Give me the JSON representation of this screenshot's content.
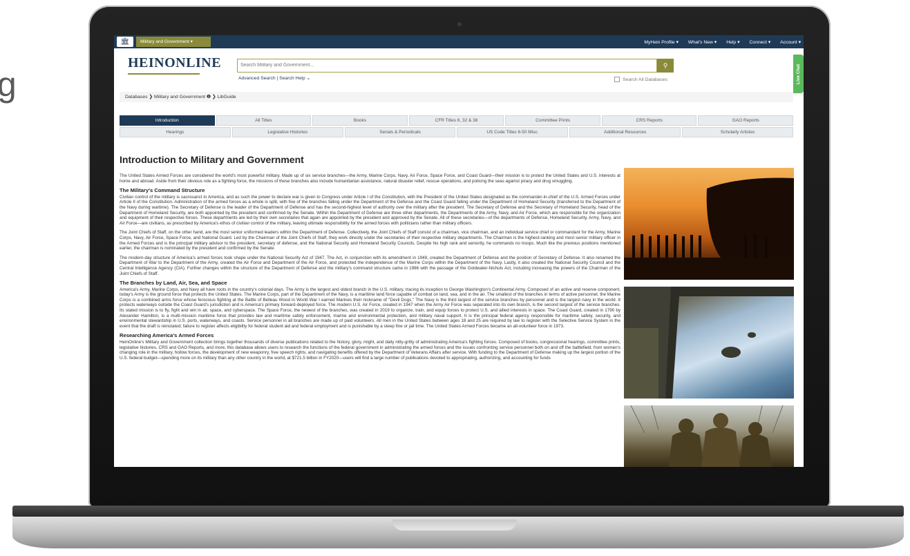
{
  "edge_text": "g",
  "topbar": {
    "db_selector": "Military and Government ▾",
    "nav": [
      "MyHein Profile ▾",
      "What's New ▾",
      "Help ▾",
      "Connect ▾",
      "Account ▾"
    ]
  },
  "header": {
    "logo": "HEINONLINE",
    "search_placeholder": "Search Military and Government...",
    "advanced_links": "Advanced Search | Search Help",
    "search_all": "Search All Databases",
    "live_chat": "Live Chat"
  },
  "breadcrumb": "Databases ❯ Military and Government ❶ ❯ LibGuide",
  "tabs": {
    "row1": [
      "Introduction",
      "All Titles",
      "Books",
      "CFR Titles 6, 32 & 38",
      "Committee Prints",
      "CRS Reports",
      "GAO Reports"
    ],
    "row2": [
      "Hearings",
      "Legislative Histories",
      "Serials & Periodicals",
      "US Code Titles 6-50 Misc.",
      "Additional Resources",
      "Scholarly Articles"
    ]
  },
  "page_title": "Introduction to Military and Government",
  "sections": {
    "intro": "The United States Armed Forces are considered the world's most powerful military. Made up of six service branches—the Army, Marine Corps, Navy, Air Force, Space Force, and Coast Guard—their mission is to protect the United States and U.S. interests at home and abroad. Aside from their obvious role as a fighting force, the missions of these branches also include humanitarian assistance, natural disaster relief, rescue operations, and policing the seas against piracy and drug smuggling.",
    "h1": "The Military's Command Structure",
    "p1": "Civilian control of the military is sacrosanct in America, and as such the power to declare war is given to Congress under Article I of the Constitution, with the President of the United States designated as the commander-in-chief of the U.S. Armed Forces under Article II of the Constitution. Administration of the armed forces as a whole is split, with five of the branches falling under the Department of the Defense and the Coast Guard falling under the Department of Homeland Security (transferred to the Department of the Navy during wartime). The Secretary of Defense is the leader of the Department of Defense and has the second-highest level of authority over the military after the president. The Secretary of Defense and the Secretary of Homeland Security, head of the Department of Homeland Security, are both appointed by the president and confirmed by the Senate. Within the Department of Defense are three other departments, the Departments of the Army, Navy, and Air Force, which are responsible for the organization and equipment of their respective forces. These departments are led by their own secretaries that again are appointed by the president and approved by the Senate. All of these secretaries—of the departments of Defense, Homeland Security, Army, Navy, and Air Force—are civilians, as prescribed by America's ethos of civilian control of the military, leaving ultimate responsibility for the armed forces with politicians rather than military officers.",
    "p2": "The Joint Chiefs of Staff, on the other hand, are the most senior uniformed leaders within the Department of Defense. Collectively, the Joint Chiefs of Staff consist of a chairman, vice chairman, and an individual service chief or commandant for the Army, Marine Corps, Navy, Air Force, Space Force, and National Guard. Led by the Chairman of the Joint Chiefs of Staff, they work directly under the secretaries of their respective military departments. The Chairman is the highest-ranking and most senior military officer in the Armed Forces and is the principal military advisor to the president, secretary of defense, and the National Security and Homeland Security Councils. Despite his high rank and seniority, he commands no troops. Much like the previous positions mentioned earlier, the chairman is nominated by the president and confirmed by the Senate.",
    "p3": "The modern-day structure of America's armed forces took shape under the National Security Act of 1947. The Act, in conjunction with its amendment in 1949, created the Department of Defense and the position of Secretary of Defense. It also renamed the Department of War to the Department of the Army, created the Air Force and Department of the Air Force, and protected the independence of the Marine Corps within the Department of the Navy. Lastly, it also created the National Security Council and the Central Intelligence Agency (CIA). Further changes within the structure of the Department of Defense and the military's command structure came in 1986 with the passage of the Goldwater-Nichols Act, including increasing the powers of the Chairman of the Joint Chiefs of Staff.",
    "h2": "The Branches by Land, Air, Sea, and Space",
    "p4": "America's Army, Marine Corps, and Navy all have roots in the country's colonial days. The Army is the largest and oldest branch in the U.S. military, tracing its inception to George Washington's Continental Army. Composed of an active and reserve component, today's Army is the ground force that protects the United States. The Marine Corps, part of the Department of the Navy, is a maritime land force capable of combat on land, sea, and in the air. The smallest of the branches in terms of active personnel, the Marine Corps is a combined arms force whose ferocious fighting at the Battle of Belleau Wood in World War I earned Marines their nickname of \"Devil Dogs.\" The Navy is the third largest of the service branches by personnel and is the largest navy in the world. It protects waterways outside the Coast Guard's jurisdiction and is America's primary forward-deployed force. The modern U.S. Air Force, created in 1947 when the Army Air Force was separated into its own branch, is the second largest of the service branches. Its stated mission is to fly, fight and win in air, space, and cyberspace. The Space Force, the newest of the branches, was created in 2019 to organize, train, and equip forces to protect U.S. and allied interests in space. The Coast Guard, created in 1790 by Alexander Hamilton, is a multi-mission maritime force that provides law and maritime safety enforcement, marine and environmental protection, and military naval support. It is the principal federal agency responsible for maritime safety, security, and environmental stewardship in U.S. ports, waterways, and coasts. Service personnel in all branches are made up of paid volunteers. All men in the United States between ages 18 and 25 are required by law to register with the Selective Service System in the event that the draft is reinstated; failure to register affects eligibility for federal student aid and federal employment and is punishable by a steep fine or jail time. The United States Armed Forces became an all-volunteer force in 1973.",
    "h3": "Researching America's Armed Forces",
    "p5": "HeinOnline's Military and Government collection brings together thousands of diverse publications related to the history, glory, might, and daily nitty-gritty of administrating America's fighting forces. Composed of books, congressional hearings, committee prints, legislative histories, CRS and GAO Reports, and more, this database allows users to research the functions of the federal government in administrating the armed forces and the issues confronting service personnel both on and off the battlefield, from women's changing role in the military, hollow forces, the development of new weaponry, free speech rights, and navigating benefits offered by the Department of Veterans Affairs after service. With funding to the Department of Defense making up the largest portion of the U.S. federal budget—spending more on its military than any other country in the world, at $721.5 billion in FY2020—users will find a large number of publications devoted to appropriating, authorizing, and accounting for funds"
  }
}
